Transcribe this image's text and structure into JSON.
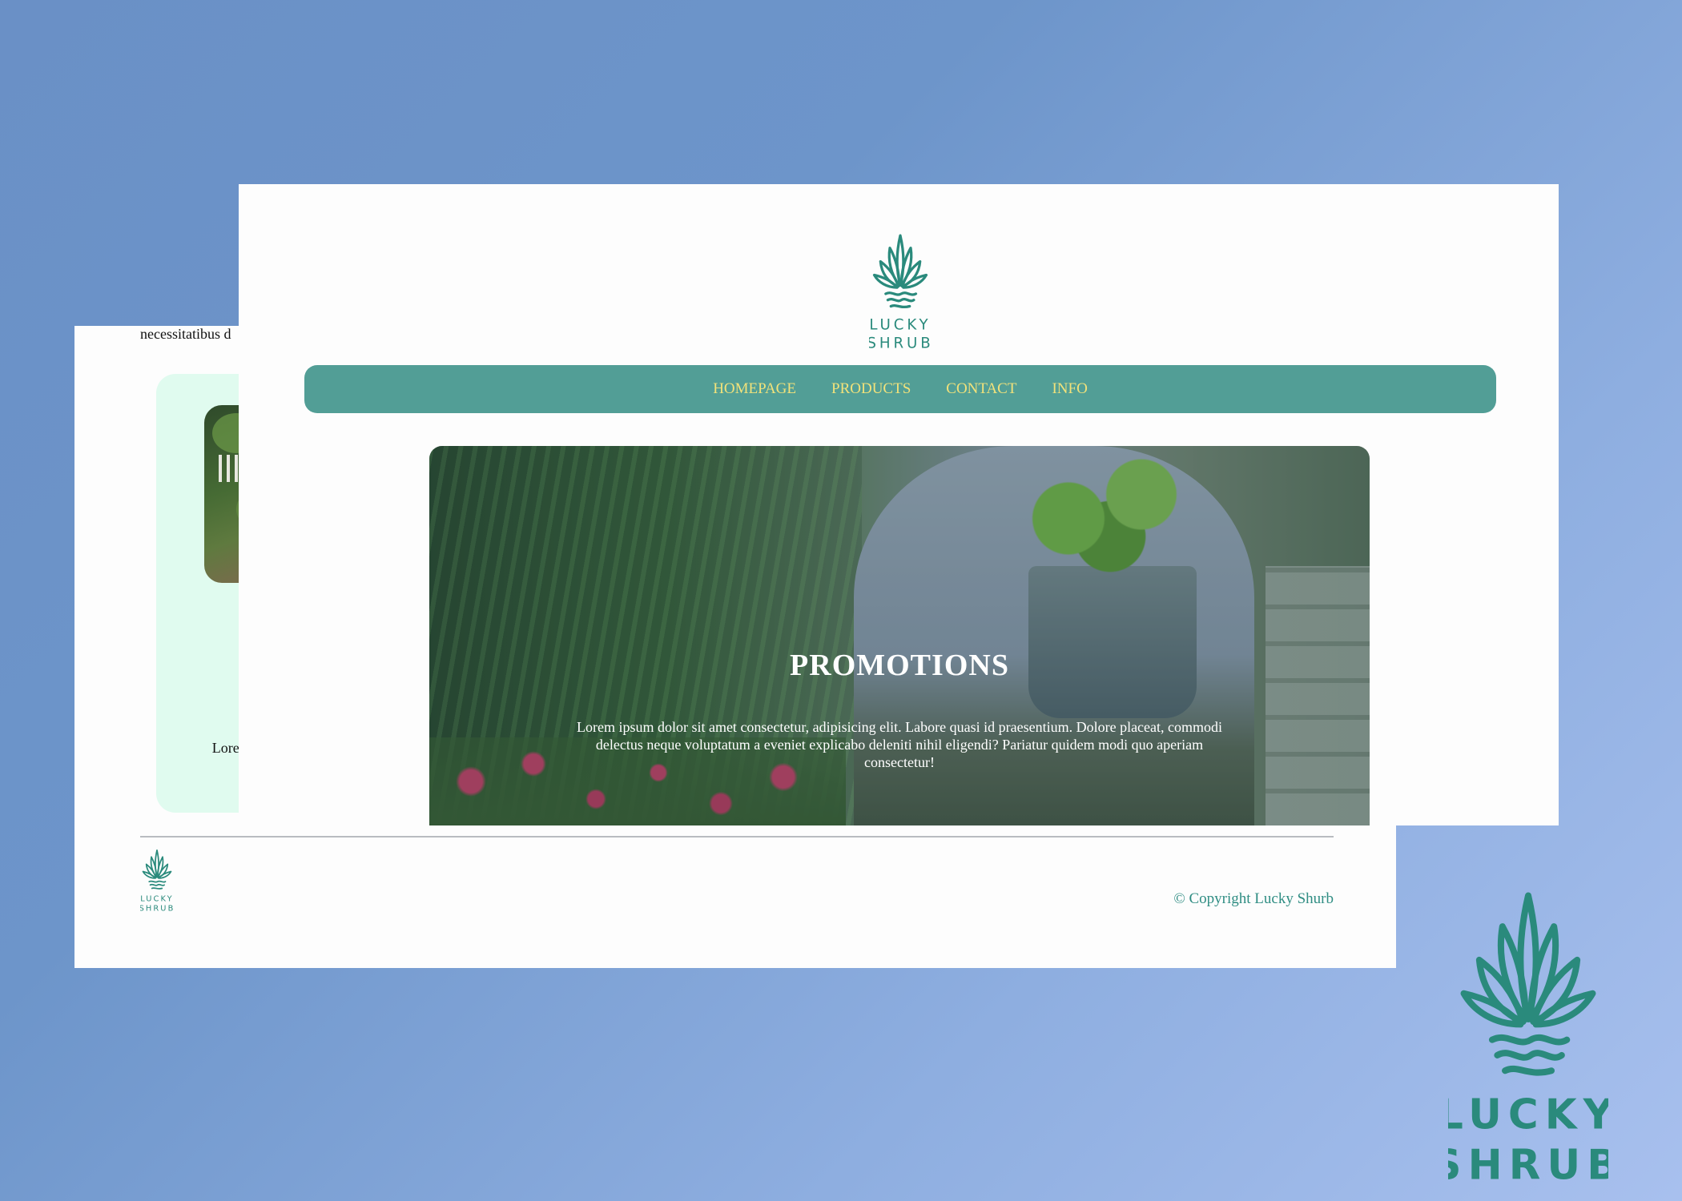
{
  "brand": {
    "name_line1": "LUCKY",
    "name_line2": "SHRUB",
    "color": "#2a8a7c"
  },
  "nav": {
    "items": [
      {
        "label": "HOMEPAGE"
      },
      {
        "label": "PRODUCTS"
      },
      {
        "label": "CONTACT"
      },
      {
        "label": "INFO"
      }
    ],
    "bar_color": "#529e96",
    "text_color": "#f2e27a"
  },
  "hero": {
    "title": "PROMOTIONS",
    "body": "Lorem ipsum dolor sit amet consectetur, adipisicing elit. Labore quasi id praesentium. Dolore placeat, commodi delectus neque voluptatum a eveniet explicabo deleniti nihil eligendi? Pariatur quidem modi quo aperiam consectetur!"
  },
  "back_page": {
    "top_text": "necessitatibus d",
    "card_text": "Lorem ips elit. Vita mollit molestiae"
  },
  "footer": {
    "copyright": "© Copyright Lucky Shurb",
    "copyright_color": "#2f8d83"
  }
}
